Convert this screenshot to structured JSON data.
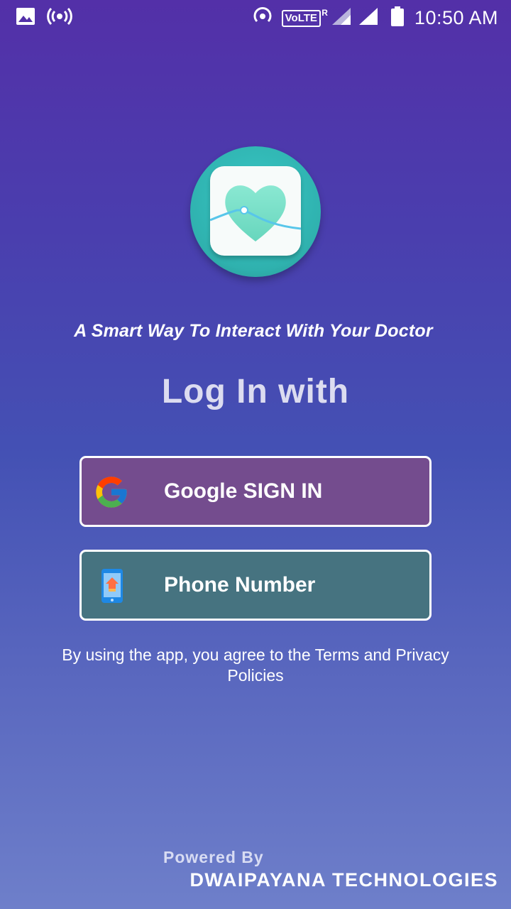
{
  "status_bar": {
    "time": "10:50 AM",
    "volte_label": "VoLTE",
    "volte_superscript": "R",
    "icons": [
      "image-icon",
      "hotspot-icon",
      "wifi-calling-icon",
      "signal-icon",
      "signal-icon",
      "battery-icon"
    ]
  },
  "app": {
    "logo_icon": "heart-pulse-logo-icon",
    "tagline": "A Smart Way To Interact With Your Doctor",
    "login_title": "Log In with"
  },
  "buttons": {
    "google": {
      "label": "Google SIGN IN",
      "icon": "google-g-icon",
      "color": "#744c8e"
    },
    "phone": {
      "label": "Phone Number",
      "icon": "phone-icon",
      "color": "#467380"
    }
  },
  "terms_text": "By using the app, you agree to the Terms and Privacy Policies",
  "footer": {
    "powered_by": "Powered By",
    "company": "DWAIPAYANA TECHNOLOGIES"
  },
  "colors": {
    "gradient_top": "#5330a8",
    "gradient_bottom": "#6e7fca",
    "logo_teal": "#38c7c5"
  }
}
